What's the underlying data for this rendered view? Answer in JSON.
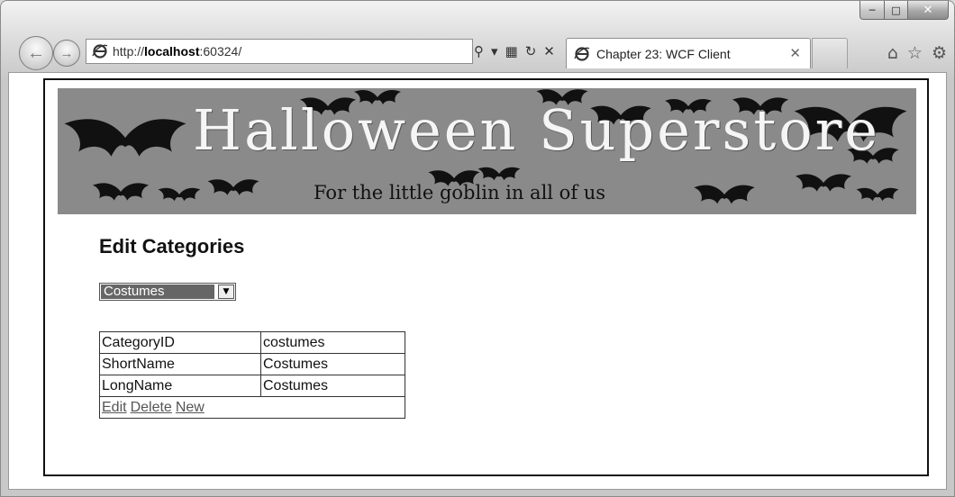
{
  "browser": {
    "address": {
      "prefix": "http://",
      "host": "localhost",
      "port_path": ":60324/"
    },
    "tab": {
      "title": "Chapter 23: WCF Client"
    },
    "icons": [
      "ie-logo-icon",
      "search-icon",
      "dropdown-icon",
      "compatibility-icon",
      "refresh-icon",
      "stop-icon",
      "home-icon",
      "favorites-star-icon",
      "settings-gear-icon"
    ]
  },
  "banner": {
    "title": "Halloween Superstore",
    "subtitle": "For the little goblin in all of us"
  },
  "page": {
    "title": "Edit Categories",
    "category_select": {
      "selected": "Costumes"
    },
    "details": {
      "rows": [
        {
          "label": "CategoryID",
          "value": "costumes"
        },
        {
          "label": "ShortName",
          "value": "Costumes"
        },
        {
          "label": "LongName",
          "value": "Costumes"
        }
      ],
      "links": {
        "edit": "Edit",
        "delete": "Delete",
        "new": "New"
      }
    }
  }
}
